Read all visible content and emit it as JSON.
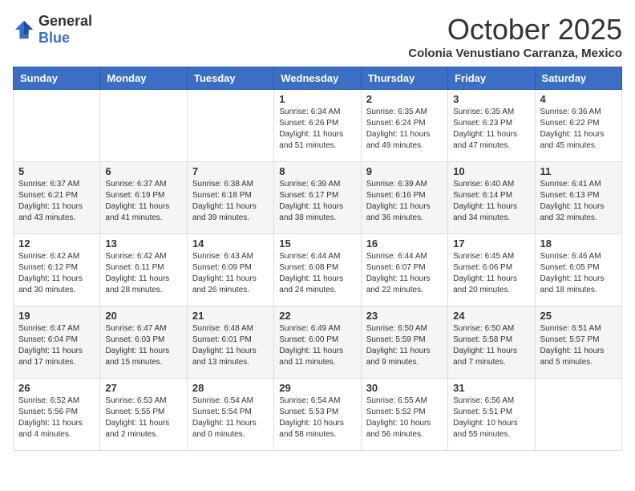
{
  "logo": {
    "text_general": "General",
    "text_blue": "Blue"
  },
  "header": {
    "month": "October 2025",
    "location": "Colonia Venustiano Carranza, Mexico"
  },
  "weekdays": [
    "Sunday",
    "Monday",
    "Tuesday",
    "Wednesday",
    "Thursday",
    "Friday",
    "Saturday"
  ],
  "weeks": [
    [
      {
        "day": "",
        "sunrise": "",
        "sunset": "",
        "daylight": ""
      },
      {
        "day": "",
        "sunrise": "",
        "sunset": "",
        "daylight": ""
      },
      {
        "day": "",
        "sunrise": "",
        "sunset": "",
        "daylight": ""
      },
      {
        "day": "1",
        "sunrise": "Sunrise: 6:34 AM",
        "sunset": "Sunset: 6:26 PM",
        "daylight": "Daylight: 11 hours and 51 minutes."
      },
      {
        "day": "2",
        "sunrise": "Sunrise: 6:35 AM",
        "sunset": "Sunset: 6:24 PM",
        "daylight": "Daylight: 11 hours and 49 minutes."
      },
      {
        "day": "3",
        "sunrise": "Sunrise: 6:35 AM",
        "sunset": "Sunset: 6:23 PM",
        "daylight": "Daylight: 11 hours and 47 minutes."
      },
      {
        "day": "4",
        "sunrise": "Sunrise: 6:36 AM",
        "sunset": "Sunset: 6:22 PM",
        "daylight": "Daylight: 11 hours and 45 minutes."
      }
    ],
    [
      {
        "day": "5",
        "sunrise": "Sunrise: 6:37 AM",
        "sunset": "Sunset: 6:21 PM",
        "daylight": "Daylight: 11 hours and 43 minutes."
      },
      {
        "day": "6",
        "sunrise": "Sunrise: 6:37 AM",
        "sunset": "Sunset: 6:19 PM",
        "daylight": "Daylight: 11 hours and 41 minutes."
      },
      {
        "day": "7",
        "sunrise": "Sunrise: 6:38 AM",
        "sunset": "Sunset: 6:18 PM",
        "daylight": "Daylight: 11 hours and 39 minutes."
      },
      {
        "day": "8",
        "sunrise": "Sunrise: 6:39 AM",
        "sunset": "Sunset: 6:17 PM",
        "daylight": "Daylight: 11 hours and 38 minutes."
      },
      {
        "day": "9",
        "sunrise": "Sunrise: 6:39 AM",
        "sunset": "Sunset: 6:16 PM",
        "daylight": "Daylight: 11 hours and 36 minutes."
      },
      {
        "day": "10",
        "sunrise": "Sunrise: 6:40 AM",
        "sunset": "Sunset: 6:14 PM",
        "daylight": "Daylight: 11 hours and 34 minutes."
      },
      {
        "day": "11",
        "sunrise": "Sunrise: 6:41 AM",
        "sunset": "Sunset: 6:13 PM",
        "daylight": "Daylight: 11 hours and 32 minutes."
      }
    ],
    [
      {
        "day": "12",
        "sunrise": "Sunrise: 6:42 AM",
        "sunset": "Sunset: 6:12 PM",
        "daylight": "Daylight: 11 hours and 30 minutes."
      },
      {
        "day": "13",
        "sunrise": "Sunrise: 6:42 AM",
        "sunset": "Sunset: 6:11 PM",
        "daylight": "Daylight: 11 hours and 28 minutes."
      },
      {
        "day": "14",
        "sunrise": "Sunrise: 6:43 AM",
        "sunset": "Sunset: 6:09 PM",
        "daylight": "Daylight: 11 hours and 26 minutes."
      },
      {
        "day": "15",
        "sunrise": "Sunrise: 6:44 AM",
        "sunset": "Sunset: 6:08 PM",
        "daylight": "Daylight: 11 hours and 24 minutes."
      },
      {
        "day": "16",
        "sunrise": "Sunrise: 6:44 AM",
        "sunset": "Sunset: 6:07 PM",
        "daylight": "Daylight: 11 hours and 22 minutes."
      },
      {
        "day": "17",
        "sunrise": "Sunrise: 6:45 AM",
        "sunset": "Sunset: 6:06 PM",
        "daylight": "Daylight: 11 hours and 20 minutes."
      },
      {
        "day": "18",
        "sunrise": "Sunrise: 6:46 AM",
        "sunset": "Sunset: 6:05 PM",
        "daylight": "Daylight: 11 hours and 18 minutes."
      }
    ],
    [
      {
        "day": "19",
        "sunrise": "Sunrise: 6:47 AM",
        "sunset": "Sunset: 6:04 PM",
        "daylight": "Daylight: 11 hours and 17 minutes."
      },
      {
        "day": "20",
        "sunrise": "Sunrise: 6:47 AM",
        "sunset": "Sunset: 6:03 PM",
        "daylight": "Daylight: 11 hours and 15 minutes."
      },
      {
        "day": "21",
        "sunrise": "Sunrise: 6:48 AM",
        "sunset": "Sunset: 6:01 PM",
        "daylight": "Daylight: 11 hours and 13 minutes."
      },
      {
        "day": "22",
        "sunrise": "Sunrise: 6:49 AM",
        "sunset": "Sunset: 6:00 PM",
        "daylight": "Daylight: 11 hours and 11 minutes."
      },
      {
        "day": "23",
        "sunrise": "Sunrise: 6:50 AM",
        "sunset": "Sunset: 5:59 PM",
        "daylight": "Daylight: 11 hours and 9 minutes."
      },
      {
        "day": "24",
        "sunrise": "Sunrise: 6:50 AM",
        "sunset": "Sunset: 5:58 PM",
        "daylight": "Daylight: 11 hours and 7 minutes."
      },
      {
        "day": "25",
        "sunrise": "Sunrise: 6:51 AM",
        "sunset": "Sunset: 5:57 PM",
        "daylight": "Daylight: 11 hours and 5 minutes."
      }
    ],
    [
      {
        "day": "26",
        "sunrise": "Sunrise: 6:52 AM",
        "sunset": "Sunset: 5:56 PM",
        "daylight": "Daylight: 11 hours and 4 minutes."
      },
      {
        "day": "27",
        "sunrise": "Sunrise: 6:53 AM",
        "sunset": "Sunset: 5:55 PM",
        "daylight": "Daylight: 11 hours and 2 minutes."
      },
      {
        "day": "28",
        "sunrise": "Sunrise: 6:54 AM",
        "sunset": "Sunset: 5:54 PM",
        "daylight": "Daylight: 11 hours and 0 minutes."
      },
      {
        "day": "29",
        "sunrise": "Sunrise: 6:54 AM",
        "sunset": "Sunset: 5:53 PM",
        "daylight": "Daylight: 10 hours and 58 minutes."
      },
      {
        "day": "30",
        "sunrise": "Sunrise: 6:55 AM",
        "sunset": "Sunset: 5:52 PM",
        "daylight": "Daylight: 10 hours and 56 minutes."
      },
      {
        "day": "31",
        "sunrise": "Sunrise: 6:56 AM",
        "sunset": "Sunset: 5:51 PM",
        "daylight": "Daylight: 10 hours and 55 minutes."
      },
      {
        "day": "",
        "sunrise": "",
        "sunset": "",
        "daylight": ""
      }
    ]
  ]
}
